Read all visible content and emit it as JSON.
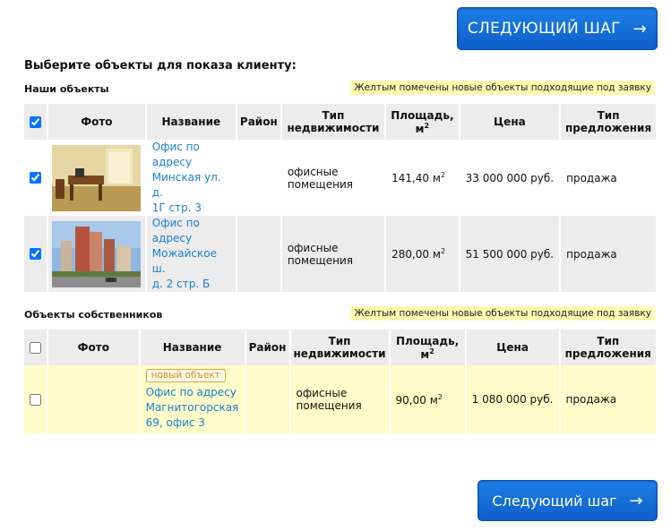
{
  "buttons": {
    "next_top": "СЛЕДУЮЩИЙ ШАГ",
    "next_bottom": "Следующий шаг",
    "arrow": "→"
  },
  "heading": "Выберите объекты для показа клиенту:",
  "note": "Желтым помечены новые объекты подходящие под заявку",
  "columns": {
    "photo": "Фото",
    "name": "Название",
    "district": "Район",
    "type_line1": "Тип",
    "type_line2": "недвижимости",
    "area_line1": "Площадь,",
    "area_line2": "м",
    "area_sup": "2",
    "price": "Цена",
    "offer_line1": "Тип",
    "offer_line2": "предложения"
  },
  "our": {
    "title": "Наши объекты",
    "rows": [
      {
        "checked": true,
        "photo_icon": "office-interior-photo",
        "name": [
          "Офис по",
          "адресу",
          "Минская ул. д.",
          "1Г стр. 3"
        ],
        "district": "",
        "type": [
          "офисные",
          "помещения"
        ],
        "area": "141,40 м",
        "area_sup": "2",
        "price": "33 000 000 руб.",
        "offer": "продажа"
      },
      {
        "checked": true,
        "photo_icon": "building-exterior-photo",
        "name": [
          "Офис по",
          "адресу",
          "Можайское ш.",
          "д. 2 стр. Б"
        ],
        "district": "",
        "type": [
          "офисные",
          "помещения"
        ],
        "area": "280,00 м",
        "area_sup": "2",
        "price": "51 500 000 руб.",
        "offer": "продажа"
      }
    ]
  },
  "owners": {
    "title": "Объекты собственников",
    "rows": [
      {
        "checked": false,
        "badge": "новый объект",
        "name": [
          "Офис по адресу",
          "Магнитогорская",
          "69, офис 3"
        ],
        "district": "",
        "type": [
          "офисные",
          "помещения"
        ],
        "area": "90,00 м",
        "area_sup": "2",
        "price": "1 080 000 руб.",
        "offer": "продажа"
      }
    ]
  },
  "colors": {
    "button": "#1470d8",
    "link": "#1a7fd0",
    "new_row": "#fefcc8",
    "note_bg": "#fbfbb0",
    "header_bg": "#ececec"
  }
}
